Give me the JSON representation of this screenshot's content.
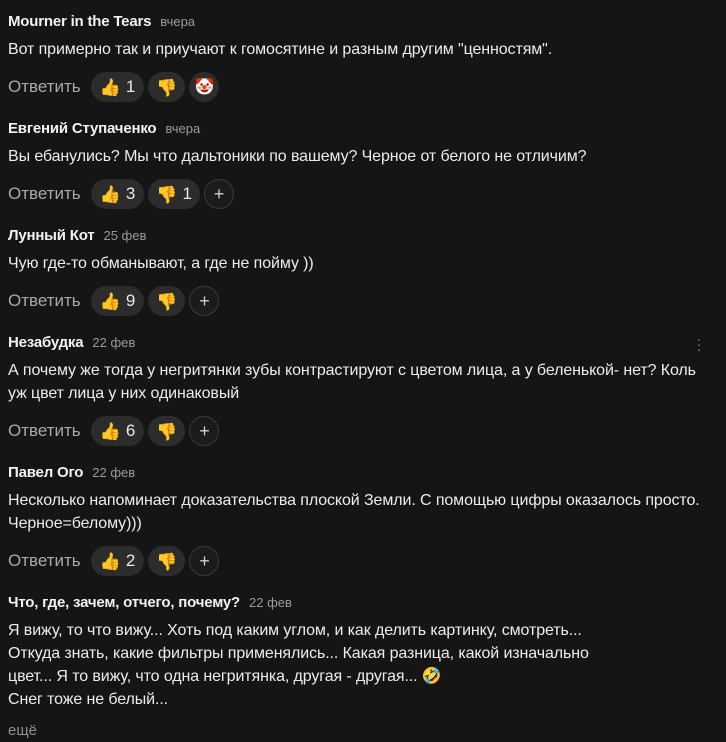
{
  "reply_label": "Ответить",
  "more_label": "ещё",
  "comments": [
    {
      "author": "Mourner in the Tears",
      "date": "вчера",
      "text": "Вот примерно так и приучают к гомосятине и разным другим \"ценностям\".",
      "likes": "1",
      "dislikes": "",
      "extra_reaction": "clown-emoji"
    },
    {
      "author": "Евгений Ступаченко",
      "date": "вчера",
      "text": "Вы ебанулись? Мы что дальтоники по вашему? Черное от белого не отличим?",
      "likes": "3",
      "dislikes": "1",
      "extra_reaction": "add"
    },
    {
      "author": "Лунный Кот",
      "date": "25 фев",
      "text": "Чую где-то обманывают, а где не пойму ))",
      "likes": "9",
      "dislikes": "",
      "extra_reaction": "add"
    },
    {
      "author": "Незабудка",
      "date": "22 фев",
      "text": "А почему же тогда у негритянки зубы контрастируют с цветом лица, а у беленькой- нет? Коль уж цвет лица у них одинаковый",
      "likes": "6",
      "dislikes": "",
      "extra_reaction": "add"
    },
    {
      "author": "Павел Ого",
      "date": "22 фев",
      "text": "Несколько напоминает доказательства плоской Земли. С помощью цифры оказалось просто. Черное=белому)))",
      "likes": "2",
      "dislikes": "",
      "extra_reaction": "add"
    },
    {
      "author": "Что, где, зачем, отчего, почему?",
      "date": "22 фев",
      "text_lines": [
        "Я вижу, то что вижу... Хоть под каким углом, и как делить картинку, смотреть...",
        "Откуда знать, какие фильтры применялись... Какая разница, какой изначально",
        "цвет... Я то вижу, что одна негритянка, другая - другая... 🤣",
        "Снег тоже не белый..."
      ]
    }
  ],
  "icons": {
    "like": "thumbs-up-icon",
    "dislike": "thumbs-down-icon",
    "add": "plus-icon",
    "menu": "kebab-menu-icon"
  }
}
